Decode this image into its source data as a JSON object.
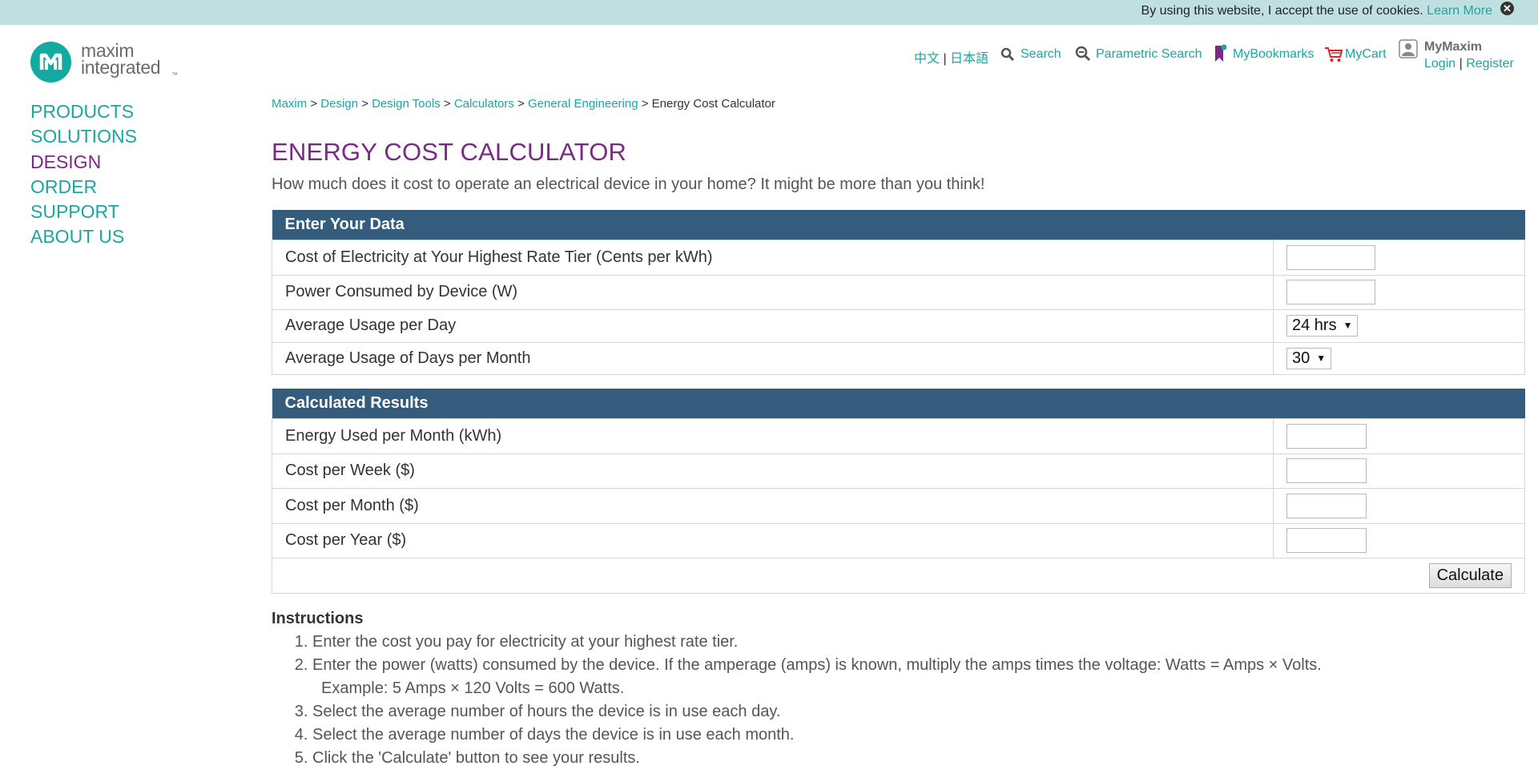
{
  "cookie": {
    "text": "By using this website, I accept the use of cookies.",
    "link": "Learn More",
    "close_glyph": "✕"
  },
  "logo": {
    "line1": "maxim",
    "line2": "integrated",
    "tm": "™"
  },
  "header": {
    "lang_chinese": "中文",
    "lang_sep": "|",
    "lang_japanese": "日本語",
    "search": "Search",
    "parametric_search": "Parametric Search",
    "bookmarks": "MyBookmarks",
    "cart": "MyCart",
    "mymaxim": "MyMaxim",
    "login": "Login",
    "login_sep": "|",
    "register": "Register"
  },
  "sidenav": {
    "items": [
      {
        "label": "PRODUCTS"
      },
      {
        "label": "SOLUTIONS"
      },
      {
        "label": "DESIGN"
      },
      {
        "label": "ORDER"
      },
      {
        "label": "SUPPORT"
      },
      {
        "label": "ABOUT US"
      }
    ]
  },
  "breadcrumb": {
    "items": [
      "Maxim",
      "Design",
      "Design Tools",
      "Calculators",
      "General Engineering"
    ],
    "separator": ">",
    "current": "Energy Cost Calculator"
  },
  "page": {
    "title": "ENERGY COST CALCULATOR",
    "subtitle": "How much does it cost to operate an electrical device in your home? It might be more than you think!"
  },
  "input_table": {
    "header": "Enter Your Data",
    "rows": {
      "cost_label": "Cost of Electricity at Your Highest Rate Tier (Cents per kWh)",
      "cost_value": "",
      "power_label": "Power Consumed by Device (W)",
      "power_value": "",
      "hours_label": "Average Usage per Day",
      "hours_value": "24 hrs",
      "days_label": "Average Usage of Days per Month",
      "days_value": "30"
    }
  },
  "results_table": {
    "header": "Calculated Results",
    "rows": {
      "energy_label": "Energy Used per Month (kWh)",
      "energy_value": "",
      "week_label": "Cost per Week ($)",
      "week_value": "",
      "month_label": "Cost per Month ($)",
      "month_value": "",
      "year_label": "Cost per Year ($)",
      "year_value": ""
    },
    "calculate_label": "Calculate"
  },
  "instructions": {
    "title": "Instructions",
    "step1": "Enter the cost you pay for electricity at your highest rate tier.",
    "step2": "Enter the power (watts) consumed by the device. If the amperage (amps) is known, multiply the amps times the voltage: Watts = Amps × Volts.",
    "step2_example": "Example: 5 Amps × 120 Volts = 600 Watts.",
    "step3": "Select the average number of hours the device is in use each day.",
    "step4": "Select the average number of days the device is in use each month.",
    "step5": "Click the 'Calculate' button to see your results."
  },
  "colors": {
    "teal": "#1aa7a0",
    "purple": "#7a2a86",
    "table_header": "#335c7d",
    "cookie_bar": "#bfdfe0"
  },
  "icons": {
    "search": "magnifier-icon",
    "parametric": "parametric-search-icon",
    "bookmarks": "bookmark-icon",
    "cart": "cart-icon",
    "user": "user-icon"
  }
}
